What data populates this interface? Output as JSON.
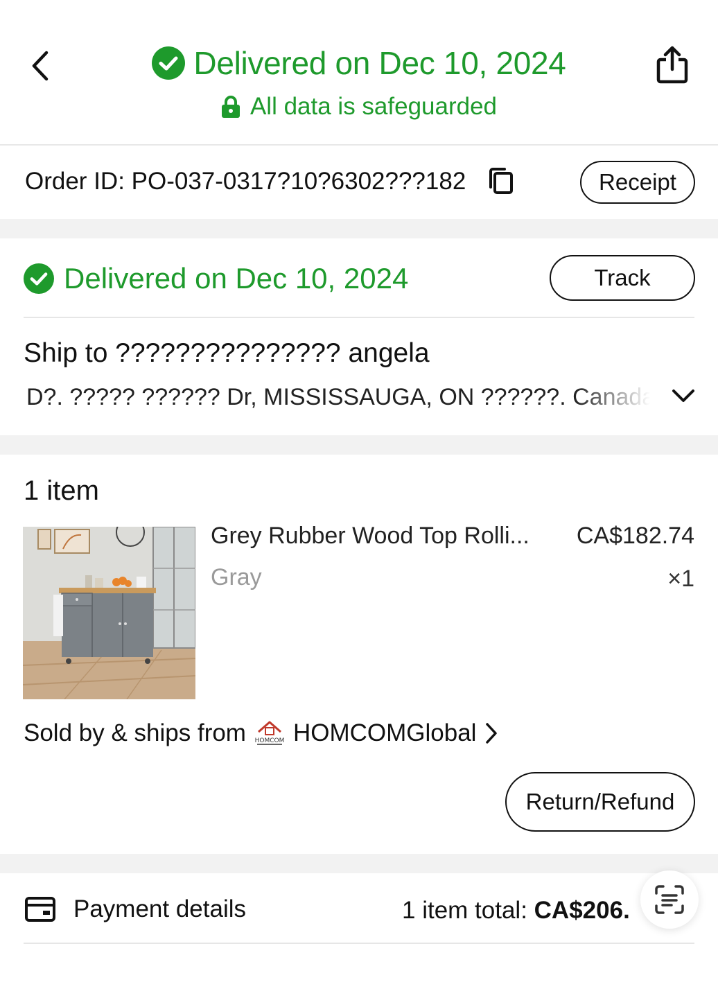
{
  "header": {
    "title": "Delivered on Dec 10, 2024",
    "subtitle": "All data is safeguarded",
    "accent_color": "#1e9a2c",
    "icons": [
      "back-chevron-icon",
      "check-circle-icon",
      "lock-icon",
      "share-icon"
    ]
  },
  "order": {
    "label": "Order ID: PO-037-0317?10?6302???182",
    "receipt_label": "Receipt",
    "icons": [
      "copy-icon"
    ]
  },
  "delivery": {
    "status": "Delivered on Dec 10, 2024",
    "track_label": "Track",
    "ship_to": "Ship to ??????????????? angela",
    "address": "D?. ????? ?????? Dr, MISSISSAUGA, ON ??????. Canada"
  },
  "items": {
    "count_label": "1 item",
    "list": [
      {
        "name": "Grey Rubber Wood Top Rolli...",
        "price": "CA$182.74",
        "variant": "Gray",
        "quantity": "×1"
      }
    ],
    "seller_prefix": "Sold by & ships from",
    "seller_name": "HOMCOMGlobal",
    "seller_logo_text": "HOMCOM",
    "return_label": "Return/Refund"
  },
  "payment": {
    "label": "Payment details",
    "total_label": "1 item total:",
    "total_value": "CA$206."
  }
}
